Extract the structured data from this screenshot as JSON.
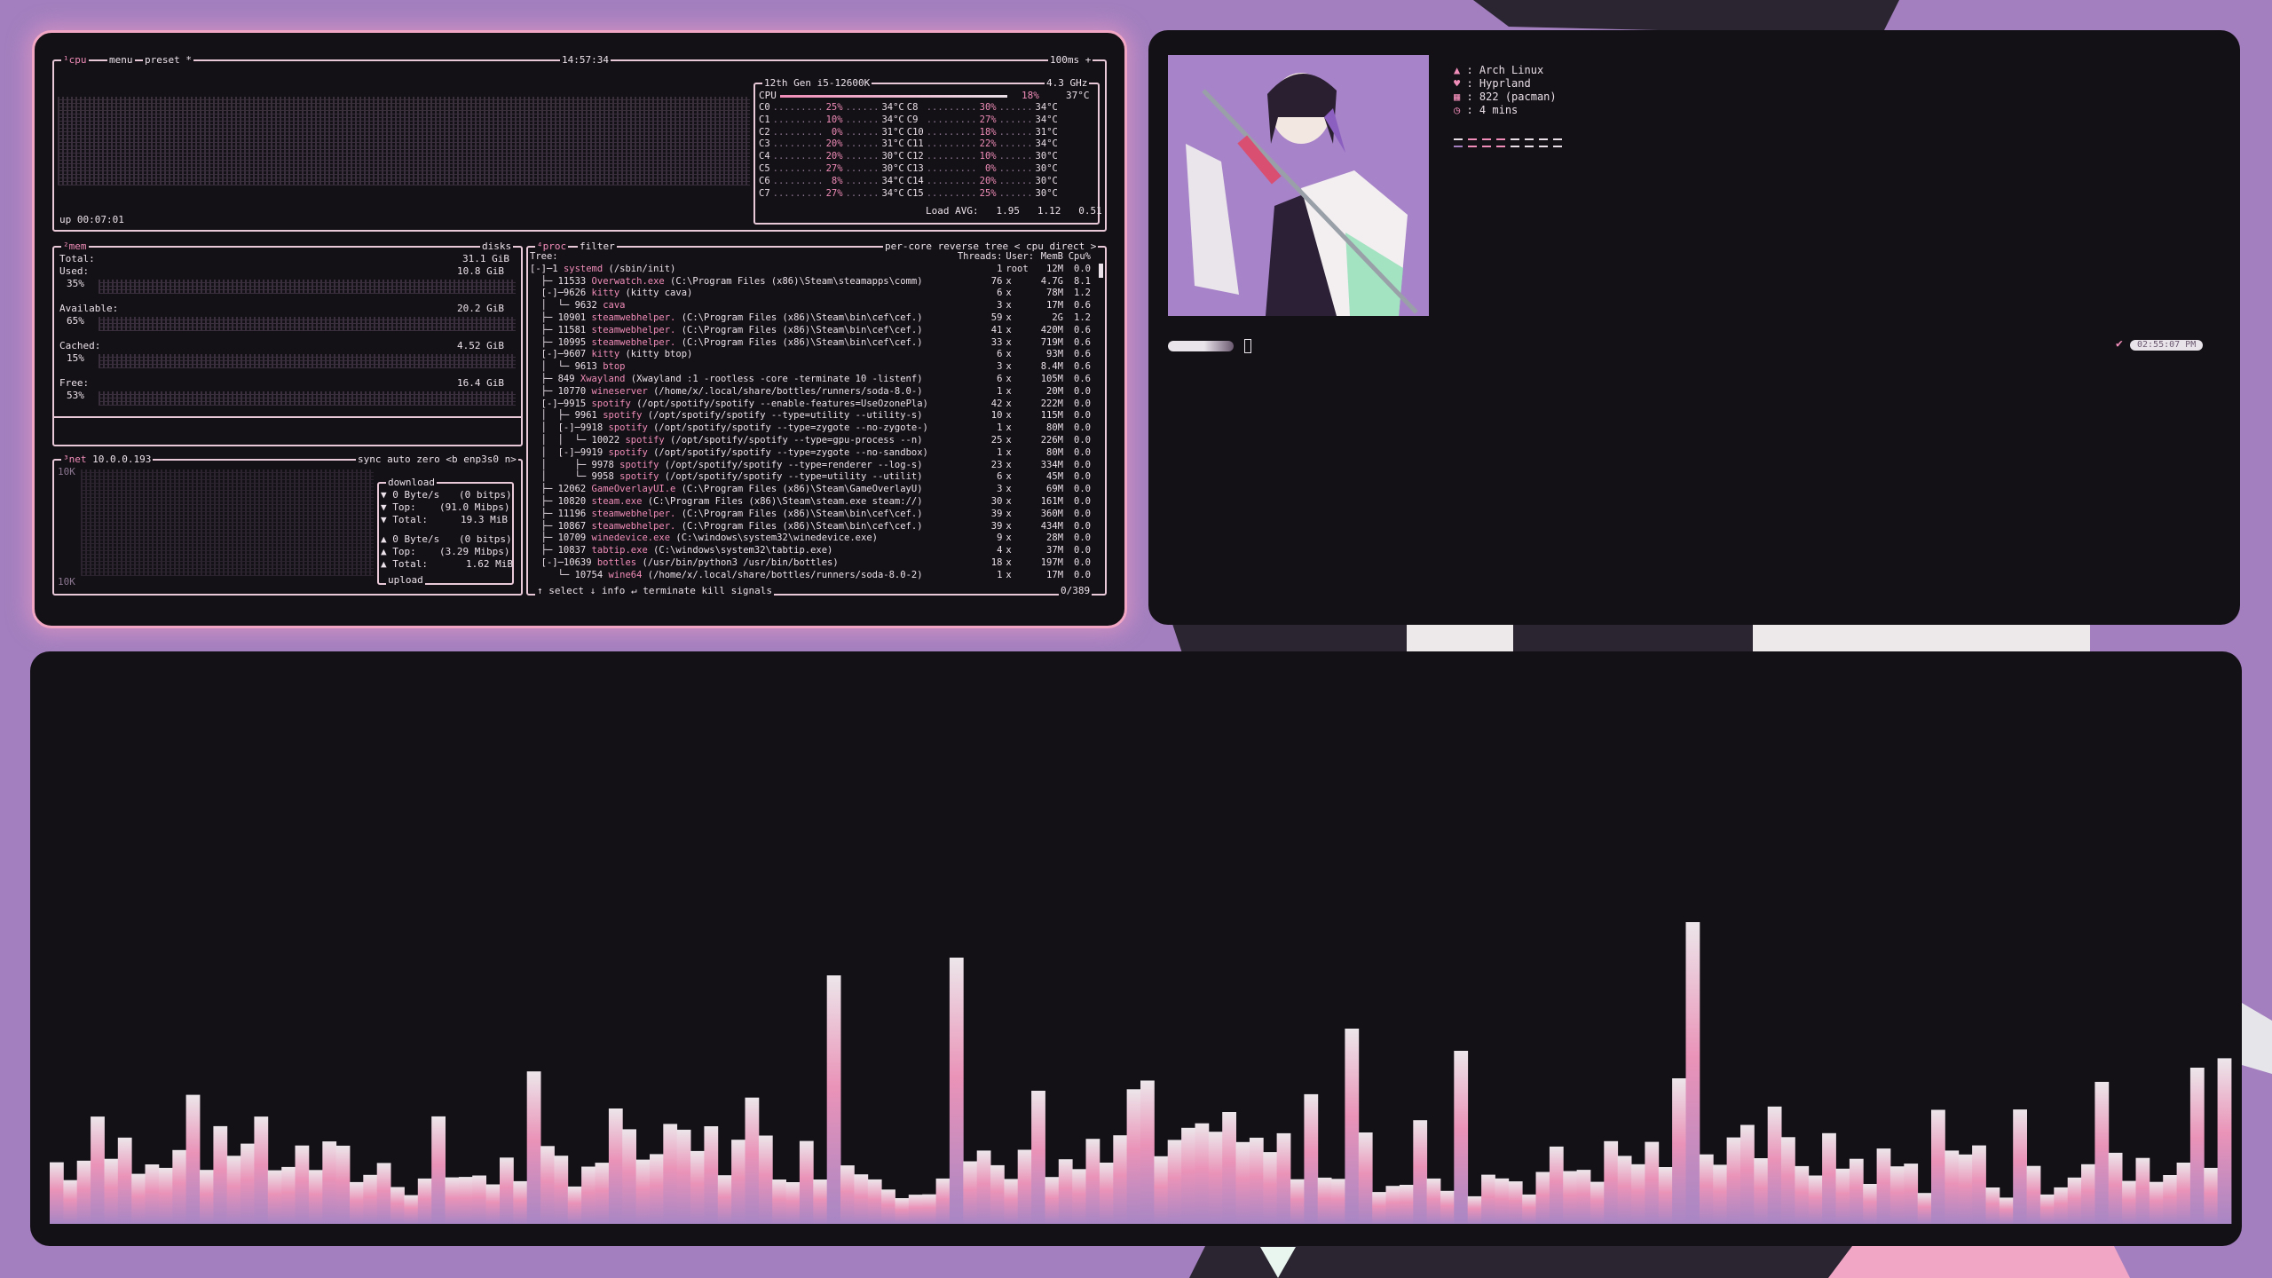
{
  "colors": {
    "accent": "#f08db8",
    "frame": "#f1a6c3",
    "bg": "#131016",
    "wallpaper": "#a37fbf"
  },
  "btop": {
    "cpu_header": {
      "tab": "¹cpu",
      "menu": "menu",
      "preset": "preset *",
      "clock": "14:57:34",
      "interval": "100ms +"
    },
    "cpu_model": "12th Gen i5-12600K",
    "cpu_freq": "4.3 GHz",
    "cpu_total": {
      "label": "CPU",
      "pct": "18%",
      "temp": "37°C"
    },
    "cores": [
      {
        "name": "C0",
        "pct": "25%",
        "temp": "34°C",
        "name2": "C8",
        "pct2": "30%",
        "temp2": "34°C"
      },
      {
        "name": "C1",
        "pct": "10%",
        "temp": "34°C",
        "name2": "C9",
        "pct2": "27%",
        "temp2": "34°C"
      },
      {
        "name": "C2",
        "pct": "0%",
        "temp": "31°C",
        "name2": "C10",
        "pct2": "18%",
        "temp2": "31°C"
      },
      {
        "name": "C3",
        "pct": "20%",
        "temp": "31°C",
        "name2": "C11",
        "pct2": "22%",
        "temp2": "34°C"
      },
      {
        "name": "C4",
        "pct": "20%",
        "temp": "30°C",
        "name2": "C12",
        "pct2": "10%",
        "temp2": "30°C"
      },
      {
        "name": "C5",
        "pct": "27%",
        "temp": "30°C",
        "name2": "C13",
        "pct2": "0%",
        "temp2": "30°C"
      },
      {
        "name": "C6",
        "pct": "8%",
        "temp": "34°C",
        "name2": "C14",
        "pct2": "20%",
        "temp2": "30°C"
      },
      {
        "name": "C7",
        "pct": "27%",
        "temp": "34°C",
        "name2": "C15",
        "pct2": "25%",
        "temp2": "30°C"
      }
    ],
    "load_avg": {
      "label": "Load AVG:",
      "v1": "1.95",
      "v2": "1.12",
      "v3": "0.51"
    },
    "uptime": "up 00:07:01",
    "mem": {
      "tab": "²mem",
      "disks": "disks",
      "total_label": "Total:",
      "total": "31.1 GiB",
      "used_label": "Used:",
      "used": "10.8 GiB",
      "used_pct": "35%",
      "used_frac": 0.35,
      "avail_label": "Available:",
      "avail": "20.2 GiB",
      "avail_pct": "65%",
      "avail_frac": 0.65,
      "cached_label": "Cached:",
      "cached": "4.52 GiB",
      "cached_pct": "15%",
      "cached_frac": 0.15,
      "free_label": "Free:",
      "free": "16.4 GiB",
      "free_pct": "53%",
      "free_frac": 0.53
    },
    "net": {
      "tab": "³net",
      "ip": "10.0.0.193",
      "sync": "sync",
      "auto": "auto",
      "zero": "zero",
      "iface": "<b enp3s0 n>",
      "scale_top": "10K",
      "scale_bottom": "10K",
      "download_label": "download",
      "dl_rate": "▼ 0 Byte/s",
      "dl_bits": "(0 bitps)",
      "dl_top": "▼ Top:",
      "dl_top_val": "(91.0 Mibps)",
      "dl_total": "▼ Total:",
      "dl_total_val": "19.3 MiB",
      "ul_rate": "▲ 0 Byte/s",
      "ul_bits": "(0 bitps)",
      "ul_top": "▲ Top:",
      "ul_top_val": "(3.29 Mibps)",
      "ul_total": "▲ Total:",
      "ul_total_val": "1.62 MiB",
      "upload_label": "upload"
    },
    "proc": {
      "tab": "⁴proc",
      "filter": "filter",
      "per_core": "per-core",
      "reverse": "reverse",
      "tree": "tree",
      "sort": "< cpu direct >",
      "col_tree": "Tree:",
      "col_threads": "Threads:",
      "col_user": "User:",
      "col_mem": "MemB",
      "col_cpu": "Cpu%",
      "rows": [
        {
          "prefix": "[-]─1 ",
          "name": "systemd",
          "args": " (/sbin/init)",
          "threads": "1",
          "user": "root",
          "mem": "12M",
          "cpu": "0.0"
        },
        {
          "prefix": "  ├─ 11533 ",
          "name": "Overwatch.exe",
          "args": " (C:\\Program Files (x86)\\Steam\\steamapps\\comm)",
          "threads": "76",
          "user": "x",
          "mem": "4.7G",
          "cpu": "8.1"
        },
        {
          "prefix": "  [-]─9626 ",
          "name": "kitty",
          "args": " (kitty cava)",
          "threads": "6",
          "user": "x",
          "mem": "78M",
          "cpu": "1.2"
        },
        {
          "prefix": "  │  └─ 9632 ",
          "name": "cava",
          "args": "",
          "threads": "3",
          "user": "x",
          "mem": "17M",
          "cpu": "0.6"
        },
        {
          "prefix": "  ├─ 10901 ",
          "name": "steamwebhelper.",
          "args": " (C:\\Program Files (x86)\\Steam\\bin\\cef\\cef.)",
          "threads": "59",
          "user": "x",
          "mem": "2G",
          "cpu": "1.2"
        },
        {
          "prefix": "  ├─ 11581 ",
          "name": "steamwebhelper.",
          "args": " (C:\\Program Files (x86)\\Steam\\bin\\cef\\cef.)",
          "threads": "41",
          "user": "x",
          "mem": "420M",
          "cpu": "0.6"
        },
        {
          "prefix": "  ├─ 10995 ",
          "name": "steamwebhelper.",
          "args": " (C:\\Program Files (x86)\\Steam\\bin\\cef\\cef.)",
          "threads": "33",
          "user": "x",
          "mem": "719M",
          "cpu": "0.6"
        },
        {
          "prefix": "  [-]─9607 ",
          "name": "kitty",
          "args": " (kitty btop)",
          "threads": "6",
          "user": "x",
          "mem": "93M",
          "cpu": "0.6"
        },
        {
          "prefix": "  │  └─ 9613 ",
          "name": "btop",
          "args": "",
          "threads": "3",
          "user": "x",
          "mem": "8.4M",
          "cpu": "0.6"
        },
        {
          "prefix": "  ├─ 849 ",
          "name": "Xwayland",
          "args": " (Xwayland :1 -rootless -core -terminate 10 -listenf)",
          "threads": "6",
          "user": "x",
          "mem": "105M",
          "cpu": "0.6"
        },
        {
          "prefix": "  ├─ 10770 ",
          "name": "wineserver",
          "args": " (/home/x/.local/share/bottles/runners/soda-8.0-)",
          "threads": "1",
          "user": "x",
          "mem": "20M",
          "cpu": "0.0"
        },
        {
          "prefix": "  [-]─9915 ",
          "name": "spotify",
          "args": " (/opt/spotify/spotify --enable-features=UseOzonePla)",
          "threads": "42",
          "user": "x",
          "mem": "222M",
          "cpu": "0.0"
        },
        {
          "prefix": "  │  ├─ 9961 ",
          "name": "spotify",
          "args": " (/opt/spotify/spotify --type=utility --utility-s)",
          "threads": "10",
          "user": "x",
          "mem": "115M",
          "cpu": "0.0"
        },
        {
          "prefix": "  │  [-]─9918 ",
          "name": "spotify",
          "args": " (/opt/spotify/spotify --type=zygote --no-zygote-)",
          "threads": "1",
          "user": "x",
          "mem": "80M",
          "cpu": "0.0"
        },
        {
          "prefix": "  │  │  └─ 10022 ",
          "name": "spotify",
          "args": " (/opt/spotify/spotify --type=gpu-process --n)",
          "threads": "25",
          "user": "x",
          "mem": "226M",
          "cpu": "0.0"
        },
        {
          "prefix": "  │  [-]─9919 ",
          "name": "spotify",
          "args": " (/opt/spotify/spotify --type=zygote --no-sandbox)",
          "threads": "1",
          "user": "x",
          "mem": "80M",
          "cpu": "0.0"
        },
        {
          "prefix": "  │     ├─ 9978 ",
          "name": "spotify",
          "args": " (/opt/spotify/spotify --type=renderer --log-s)",
          "threads": "23",
          "user": "x",
          "mem": "334M",
          "cpu": "0.0"
        },
        {
          "prefix": "  │     └─ 9958 ",
          "name": "spotify",
          "args": " (/opt/spotify/spotify --type=utility --utilit)",
          "threads": "6",
          "user": "x",
          "mem": "45M",
          "cpu": "0.0"
        },
        {
          "prefix": "  ├─ 12062 ",
          "name": "GameOverlayUI.e",
          "args": " (C:\\Program Files (x86)\\Steam\\GameOverlayU)",
          "threads": "3",
          "user": "x",
          "mem": "69M",
          "cpu": "0.0"
        },
        {
          "prefix": "  ├─ 10820 ",
          "name": "steam.exe",
          "args": " (C:\\Program Files (x86)\\Steam\\steam.exe steam://)",
          "threads": "30",
          "user": "x",
          "mem": "161M",
          "cpu": "0.0"
        },
        {
          "prefix": "  ├─ 11196 ",
          "name": "steamwebhelper.",
          "args": " (C:\\Program Files (x86)\\Steam\\bin\\cef\\cef.)",
          "threads": "39",
          "user": "x",
          "mem": "360M",
          "cpu": "0.0"
        },
        {
          "prefix": "  ├─ 10867 ",
          "name": "steamwebhelper.",
          "args": " (C:\\Program Files (x86)\\Steam\\bin\\cef\\cef.)",
          "threads": "39",
          "user": "x",
          "mem": "434M",
          "cpu": "0.0"
        },
        {
          "prefix": "  ├─ 10709 ",
          "name": "winedevice.exe",
          "args": " (C:\\windows\\system32\\winedevice.exe)",
          "threads": "9",
          "user": "x",
          "mem": "28M",
          "cpu": "0.0"
        },
        {
          "prefix": "  ├─ 10837 ",
          "name": "tabtip.exe",
          "args": " (C:\\windows\\system32\\tabtip.exe)",
          "threads": "4",
          "user": "x",
          "mem": "37M",
          "cpu": "0.0"
        },
        {
          "prefix": "  [-]─10639 ",
          "name": "bottles",
          "args": " (/usr/bin/python3 /usr/bin/bottles)",
          "threads": "18",
          "user": "x",
          "mem": "197M",
          "cpu": "0.0"
        },
        {
          "prefix": "     └─ 10754 ",
          "name": "wine64",
          "args": " (/home/x/.local/share/bottles/runners/soda-8.0-2)",
          "threads": "1",
          "user": "x",
          "mem": "17M",
          "cpu": "0.0"
        }
      ],
      "footer": {
        "select": "↑ select ↓",
        "info": "info ↵",
        "terminate": "terminate",
        "kill": "kill",
        "signals": "signals",
        "count": "0/389"
      }
    }
  },
  "fetch": {
    "items": [
      {
        "icon": "arch-icon",
        "glyph": "▲",
        "text": "Arch Linux"
      },
      {
        "icon": "heart-icon",
        "glyph": "♥",
        "text": "Hyprland"
      },
      {
        "icon": "package-icon",
        "glyph": "▦",
        "text": "822 (pacman)"
      },
      {
        "icon": "clock-icon",
        "glyph": "◷",
        "text": "4 mins"
      }
    ],
    "time_pill": "02:55:07 PM"
  },
  "cava": {
    "bars": 160
  }
}
